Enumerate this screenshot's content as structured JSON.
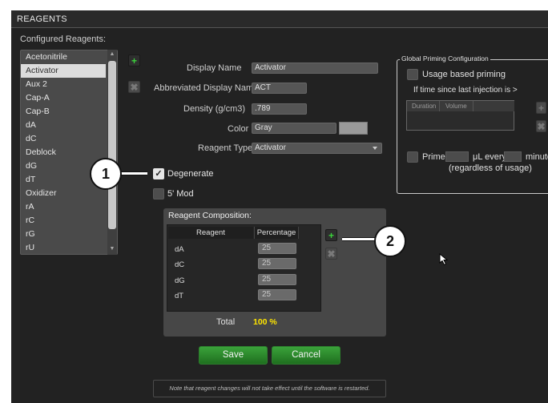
{
  "window": {
    "title": "REAGENTS"
  },
  "configured_reagents": {
    "label": "Configured Reagents:",
    "selected": "Activator",
    "items": [
      "Acetonitrile",
      "Activator",
      "Aux 2",
      "Cap-A",
      "Cap-B",
      "dA",
      "dC",
      "Deblock",
      "dG",
      "dT",
      "Oxidizer",
      "rA",
      "rC",
      "rG",
      "rU"
    ]
  },
  "form": {
    "display_name": {
      "label": "Display Name",
      "value": "Activator"
    },
    "abbreviated_display_name": {
      "label": "Abbreviated Display Name",
      "value": "ACT"
    },
    "density": {
      "label": "Density (g/cm3)",
      "value": ".789"
    },
    "color": {
      "label": "Color",
      "value": "Gray",
      "swatch": "#9a9a9a"
    },
    "reagent_type": {
      "label": "Reagent Type",
      "value": "Activator"
    }
  },
  "options": {
    "degenerate": {
      "label": "Degenerate",
      "checked": true
    },
    "five_prime_mod": {
      "label": "5' Mod",
      "checked": false
    }
  },
  "global_priming": {
    "title": "Global Priming Configuration",
    "usage_based_priming": "Usage based priming",
    "if_time_since": "If time since last injection is >",
    "columns": [
      "Duration",
      "Volume"
    ],
    "prime_label": "Prime",
    "ul_every": "μL every",
    "minutes": "minute",
    "regardless": "(regardless of usage)"
  },
  "composition": {
    "title": "Reagent Composition:",
    "columns": [
      "Reagent",
      "Percentage"
    ],
    "rows": [
      {
        "reagent": "dA",
        "percentage": "25"
      },
      {
        "reagent": "dC",
        "percentage": "25"
      },
      {
        "reagent": "dG",
        "percentage": "25"
      },
      {
        "reagent": "dT",
        "percentage": "25"
      }
    ],
    "total_label": "Total",
    "total_value": "100 %",
    "total_color": "#ffe500"
  },
  "buttons": {
    "save": "Save",
    "cancel": "Cancel"
  },
  "note": "Note that reagent changes will not take effect until the software is restarted.",
  "callouts": {
    "one": "1",
    "two": "2"
  },
  "colors": {
    "accent_green": "#2e9a2e",
    "add_icon_green": "#3bd13b",
    "panel_bg": "#222222"
  }
}
